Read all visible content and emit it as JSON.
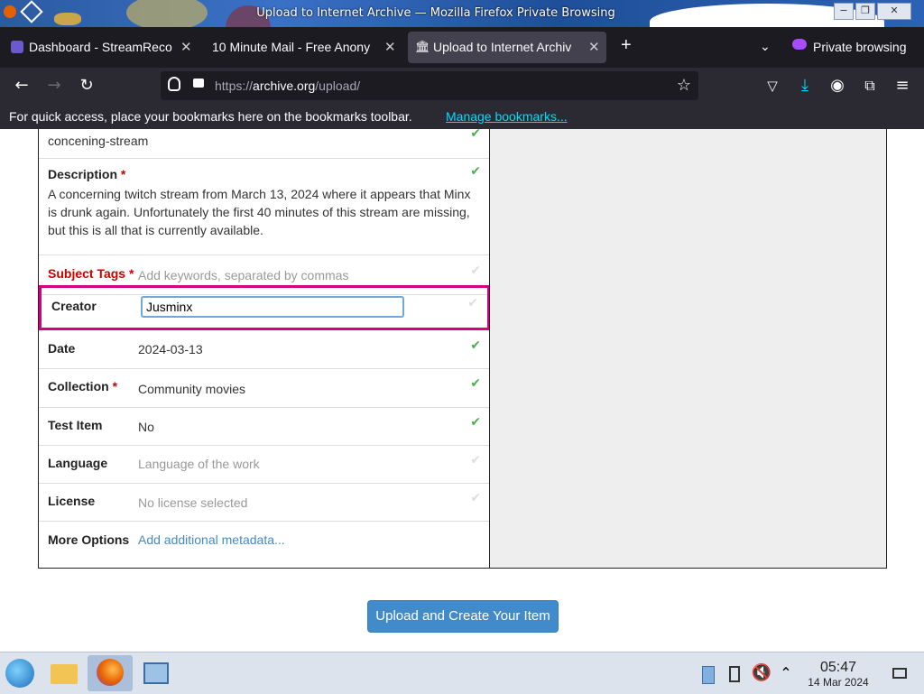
{
  "window": {
    "title": "Upload to Internet Archive — Mozilla Firefox Private Browsing"
  },
  "tabs": [
    {
      "label": "Dashboard - StreamReco",
      "active": false
    },
    {
      "label": "10 Minute Mail - Free Anony",
      "active": false
    },
    {
      "label": "Upload to Internet Archiv",
      "active": true
    }
  ],
  "private_label": "Private browsing",
  "url": {
    "prefix": "https://",
    "host": "archive.org",
    "path": "/upload/"
  },
  "bookmarks_bar": {
    "message": "For quick access, place your bookmarks here on the bookmarks toolbar.",
    "link": "Manage bookmarks..."
  },
  "form": {
    "identifier_value": "concening-stream",
    "description": {
      "label": "Description",
      "value": "A concerning twitch stream from March 13, 2024 where it appears that Minx is drunk again. Unfortunately the first 40 minutes of this stream are missing, but this is all that is currently available."
    },
    "subject_tags": {
      "label": "Subject Tags",
      "placeholder": "Add keywords, separated by commas"
    },
    "creator": {
      "label": "Creator",
      "value": "Jusminx"
    },
    "date": {
      "label": "Date",
      "value": "2024-03-13"
    },
    "collection": {
      "label": "Collection",
      "value": "Community movies"
    },
    "test_item": {
      "label": "Test Item",
      "value": "No"
    },
    "language": {
      "label": "Language",
      "placeholder": "Language of the work"
    },
    "license": {
      "label": "License",
      "placeholder": "No license selected"
    },
    "more_options": {
      "label": "More Options",
      "link": "Add additional metadata..."
    },
    "required_mark": "*",
    "check_glyph": "✔"
  },
  "upload_button": "Upload and Create Your Item",
  "taskbar": {
    "time": "05:47",
    "date": "14 Mar 2024"
  },
  "colors": {
    "accent_highlight": "#d6007e",
    "button_blue": "#428bca",
    "check_green": "#4caf50"
  }
}
